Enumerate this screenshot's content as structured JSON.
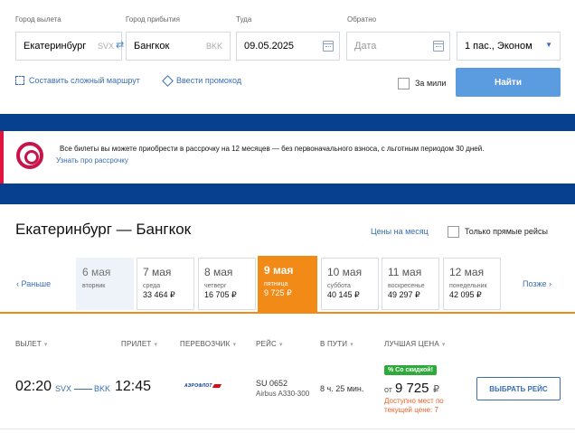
{
  "search": {
    "from_label": "Город вылета",
    "from_value": "Екатеринбург",
    "from_code": "SVX",
    "to_label": "Город прибытия",
    "to_value": "Бангкок",
    "to_code": "BKK",
    "depart_label": "Туда",
    "depart_value": "09.05.2025",
    "return_label": "Обратно",
    "return_placeholder": "Дата",
    "passengers_value": "1 пас., Эконом",
    "complex_route_link": "Составить сложный маршрут",
    "promo_link": "Ввести промокод",
    "miles_label": "За мили",
    "find_button": "Найти"
  },
  "banner": {
    "text": "Все билеты вы можете приобрести в рассрочку на 12 месяцев — без первоначального взноса, с льготным периодом 30 дней.",
    "link": "Узнать про рассрочку"
  },
  "route": {
    "title": "Екатеринбург — Бангкок",
    "month_prices_link": "Цены на месяц",
    "direct_only_label": "Только прямые рейсы",
    "earlier": "Раньше",
    "later": "Позже"
  },
  "dates": [
    {
      "date": "6 мая",
      "weekday": "вторник",
      "price": ""
    },
    {
      "date": "7 мая",
      "weekday": "среда",
      "price": "33 464 ₽"
    },
    {
      "date": "8 мая",
      "weekday": "четверг",
      "price": "16 705 ₽"
    },
    {
      "date": "9 мая",
      "weekday": "пятница",
      "price": "9 725 ₽"
    },
    {
      "date": "10 мая",
      "weekday": "суббота",
      "price": "40 145 ₽"
    },
    {
      "date": "11 мая",
      "weekday": "воскресенье",
      "price": "49 297 ₽"
    },
    {
      "date": "12 мая",
      "weekday": "понедельник",
      "price": "42 095 ₽"
    }
  ],
  "columns": {
    "departure": "ВЫЛЕТ",
    "arrival": "ПРИЛЕТ",
    "carrier": "ПЕРЕВОЗЧИК",
    "flight": "РЕЙС",
    "duration": "В ПУТИ",
    "best_price": "ЛУЧШАЯ ЦЕНА"
  },
  "flight": {
    "dep_time": "02:20",
    "dep_code": "SVX",
    "arr_code": "BKK",
    "arr_time": "12:45",
    "carrier_logo_text": "АЭРОФЛОТ",
    "number": "SU 0652",
    "aircraft": "Airbus A330-300",
    "duration": "8 ч. 25 мин.",
    "discount_badge": "% Со скидкой!",
    "price_from": "от",
    "price": "9 725",
    "currency": "₽",
    "availability": "Доступно мест по текущей цене: 7",
    "choose_button": "ВЫБРАТЬ РЕЙС"
  }
}
